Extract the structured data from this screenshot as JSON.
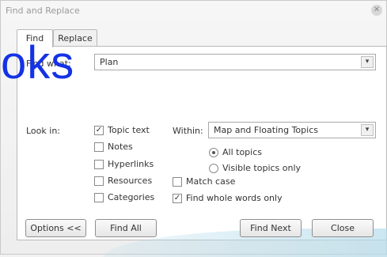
{
  "window": {
    "title": "Find and Replace"
  },
  "tabs": [
    {
      "label": "Find"
    },
    {
      "label": "Replace"
    }
  ],
  "find_what": {
    "label": "Find what:",
    "value": "Plan"
  },
  "overlay_text": "oks",
  "look_in": {
    "label": "Look in:",
    "options": [
      {
        "label": "Topic text",
        "checked": true
      },
      {
        "label": "Notes",
        "checked": false
      },
      {
        "label": "Hyperlinks",
        "checked": false
      },
      {
        "label": "Resources",
        "checked": false
      },
      {
        "label": "Categories",
        "checked": false
      }
    ]
  },
  "within": {
    "label": "Within:",
    "value": "Map and Floating Topics",
    "radios": [
      {
        "label": "All topics",
        "selected": true
      },
      {
        "label": "Visible topics only",
        "selected": false
      }
    ]
  },
  "match_case": {
    "label": "Match case",
    "checked": false
  },
  "whole_words": {
    "label": "Find whole words only",
    "checked": true
  },
  "buttons": {
    "options": "Options <<",
    "find_all": "Find All",
    "find_next": "Find Next",
    "close": "Close"
  },
  "glyphs": {
    "check": "✓",
    "dropdown": "▾",
    "close": "✕"
  }
}
